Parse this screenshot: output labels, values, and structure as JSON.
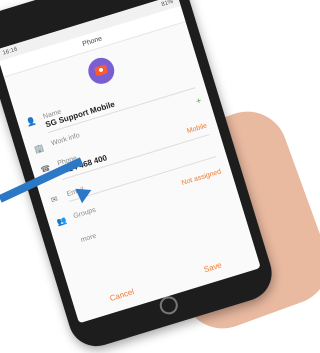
{
  "status_bar": {
    "time": "16:16",
    "battery": "81%"
  },
  "app": {
    "title": "Phone"
  },
  "fields": {
    "name_label": "Name",
    "name_value": "SG Support Mobile",
    "work_info_label": "Work info",
    "phone_label": "Phone",
    "phone_value": "0414 468 400",
    "phone_type": "Mobile",
    "email_label": "Email",
    "groups_label": "Groups",
    "groups_value": "Not assigned",
    "more_label": "more"
  },
  "buttons": {
    "cancel": "Cancel",
    "save": "Save"
  },
  "colors": {
    "accent": "#ef7a2f",
    "avatar_bg": "#7a5fd3",
    "arrow": "#2b78c7"
  }
}
